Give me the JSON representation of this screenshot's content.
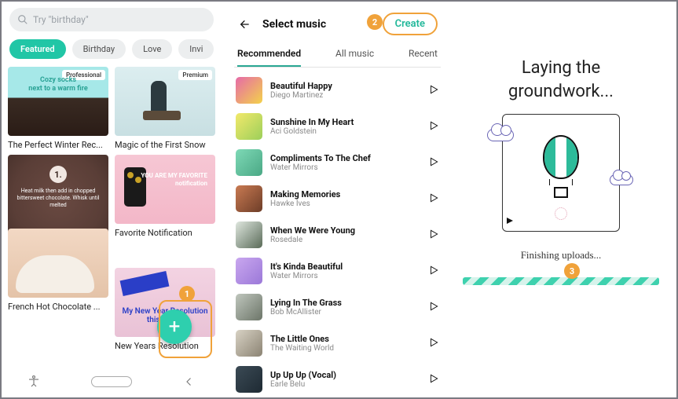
{
  "search": {
    "placeholder": "Try \"birthday\""
  },
  "chips": [
    "Featured",
    "Birthday",
    "Love",
    "Invi"
  ],
  "active_chip_index": 0,
  "cards": [
    {
      "title": "The Perfect Winter Rec...",
      "badge": "Professional",
      "overlay_line1": "Cozy socks",
      "overlay_line2": "next to a warm fire"
    },
    {
      "title": "Magic of the First Snow",
      "badge": "Premium"
    },
    {
      "title": "",
      "step_num": "1.",
      "recipe_text": "Heat milk then add in chopped bittersweet chocolate. Whisk until melted"
    },
    {
      "title": "Favorite Notification",
      "overlay_text": "YOU ARE MY FAVORITE notification"
    },
    {
      "title": "French Hot Chocolate ..."
    },
    {
      "title": "New Years Resolution",
      "overlay_text": "My New Year Resolution this year..."
    }
  ],
  "callouts": {
    "one": "1",
    "two": "2",
    "three": "3"
  },
  "music": {
    "header": "Select music",
    "create": "Create",
    "tabs": [
      "Recommended",
      "All music",
      "Recent"
    ],
    "active_tab_index": 0,
    "songs": [
      {
        "title": "Beautiful Happy",
        "artist": "Diego Martinez",
        "cover": "linear-gradient(135deg,#e66aa8,#f3d24a)"
      },
      {
        "title": "Sunshine In My Heart",
        "artist": "Aci Goldstein",
        "cover": "linear-gradient(135deg,#f2e96b,#9ccf5a)"
      },
      {
        "title": "Compliments To The Chef",
        "artist": "Water Mirrors",
        "cover": "linear-gradient(135deg,#7ed9b6,#4aa885)"
      },
      {
        "title": "Making Memories",
        "artist": "Hawke Ives",
        "cover": "linear-gradient(135deg,#c97a52,#6d3d28)"
      },
      {
        "title": "When We Were Young",
        "artist": "Rosedale",
        "cover": "linear-gradient(135deg,#dfe7df,#5a6b58)"
      },
      {
        "title": "It's Kinda Beautiful",
        "artist": "Water Mirrors",
        "cover": "linear-gradient(135deg,#c9a7ef,#9b78d8)"
      },
      {
        "title": "Lying In The Grass",
        "artist": "Bob McAllister",
        "cover": "linear-gradient(135deg,#bfc6bd,#6c7568)"
      },
      {
        "title": "The Little Ones",
        "artist": "The Waiting World",
        "cover": "linear-gradient(135deg,#d8d2c4,#8b8373)"
      },
      {
        "title": "Up Up Up (Vocal)",
        "artist": "Earle Belu",
        "cover": "linear-gradient(135deg,#3b4a55,#1e2a33)"
      }
    ]
  },
  "loading": {
    "title_l1": "Laying the",
    "title_l2": "groundwork...",
    "status": "Finishing uploads..."
  }
}
